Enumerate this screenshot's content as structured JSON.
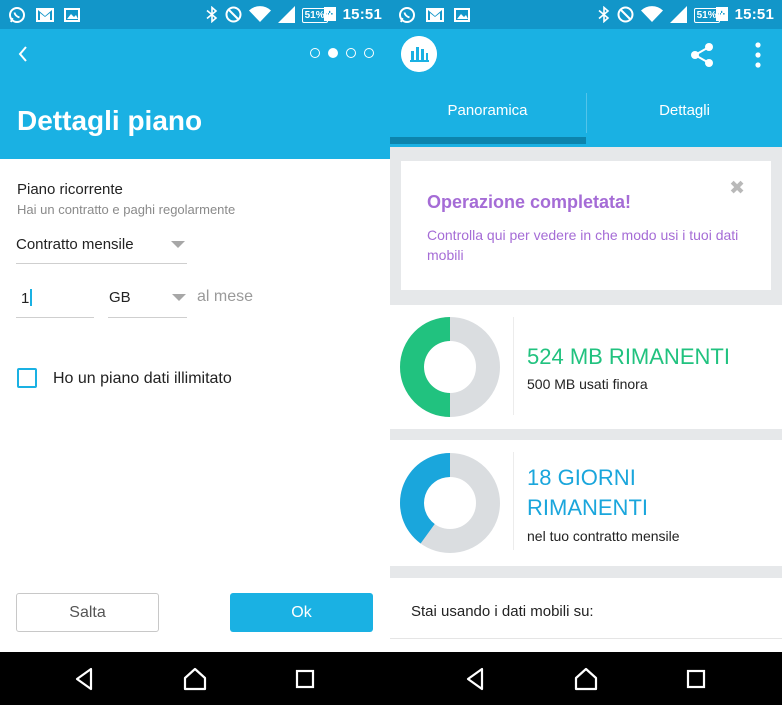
{
  "status_bar": {
    "time": "15:51",
    "battery": "51%",
    "notification_icons": [
      "whatsapp-icon",
      "gmail-icon",
      "gallery-icon"
    ],
    "system_icons": [
      "bluetooth-icon",
      "do-not-disturb-icon",
      "wifi-icon",
      "signal-icon",
      "battery-icon"
    ],
    "bar_color": "#1296c9"
  },
  "left_screen": {
    "title": "Dettagli piano",
    "step_total": 4,
    "step_active": 2,
    "plan_label": "Piano ricorrente",
    "plan_sublabel": "Hai un contratto e paghi regolarmente",
    "contract_select": "Contratto mensile",
    "amount_value": "1",
    "unit_select": "GB",
    "per_month": "al mese",
    "unlimited_checkbox_label": "Ho un piano dati illimitato",
    "unlimited_checked": false,
    "skip_button": "Salta",
    "ok_button": "Ok",
    "accent_color": "#1ab1e3"
  },
  "right_screen": {
    "tabs": [
      {
        "label": "Panoramica",
        "active": true
      },
      {
        "label": "Dettagli",
        "active": false
      }
    ],
    "success_card": {
      "title": "Operazione completata!",
      "text": "Controlla qui per vedere in che modo usi i tuoi dati mobili",
      "color": "#a56cd6"
    },
    "data_card": {
      "headline": "524 MB RIMANENTI",
      "subline": "500 MB usati finora",
      "used_fraction": 0.5,
      "color": "#21c27f"
    },
    "days_card": {
      "headline": "18 GIORNI RIMANENTI",
      "subline": "nel tuo contratto mensile",
      "elapsed_fraction": 0.4,
      "color": "#1aa6dc"
    },
    "usage_label": "Stai usando i dati mobili su:"
  }
}
